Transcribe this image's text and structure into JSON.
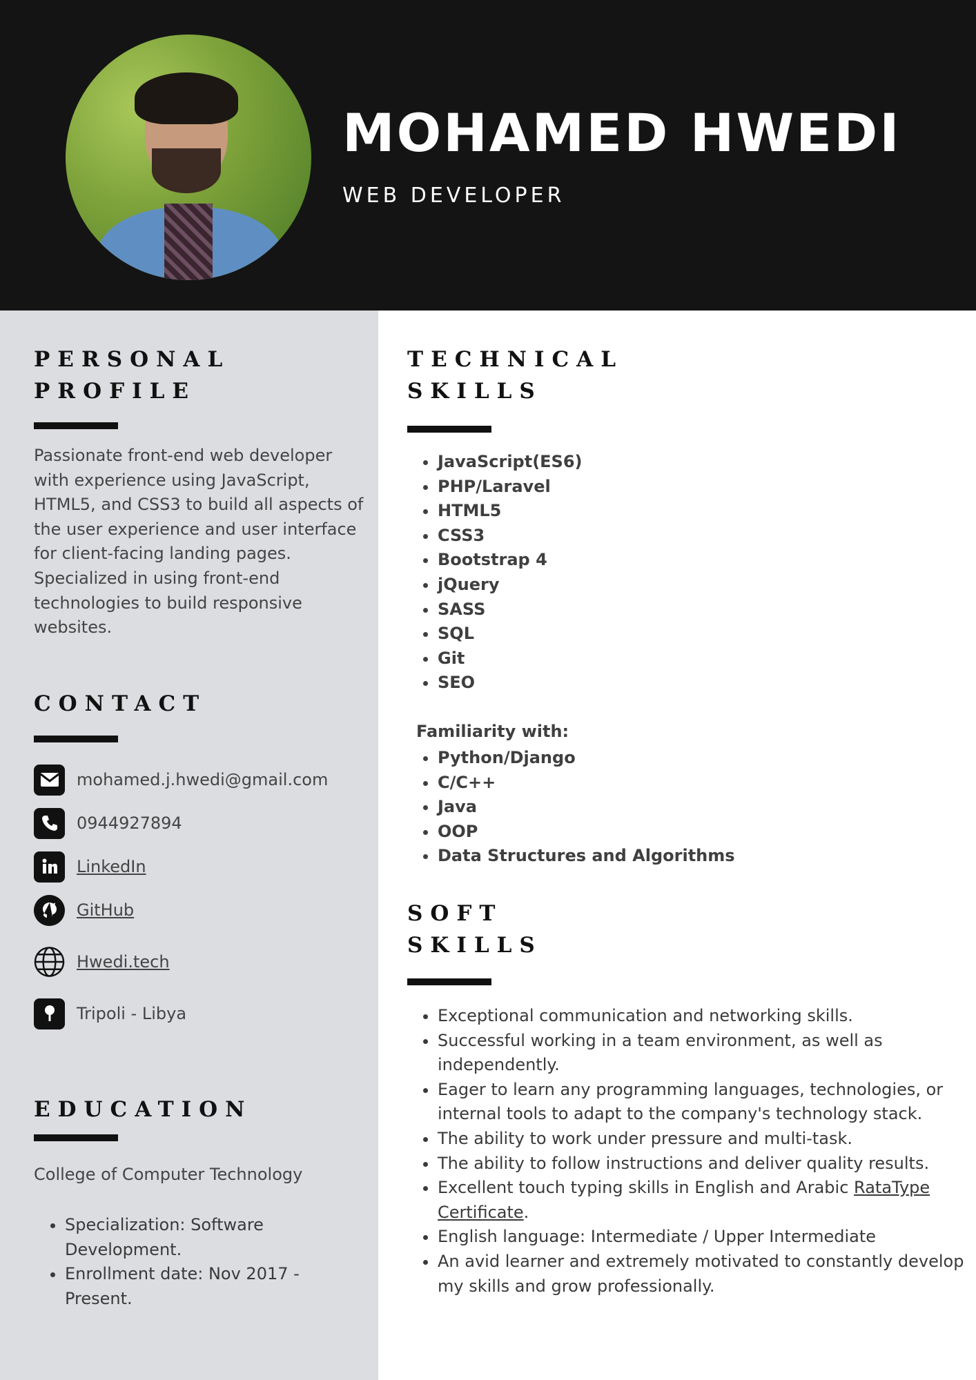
{
  "header": {
    "name": "MOHAMED HWEDI",
    "title": "WEB DEVELOPER",
    "photo_icon": "profile-photo"
  },
  "profile": {
    "heading": "PERSONAL\nPROFILE",
    "text": "Passionate front-end web developer with experience using JavaScript, HTML5, and CSS3 to build all aspects of the user experience and user interface for client-facing landing pages. Specialized in using front-end technologies to build responsive websites."
  },
  "contact": {
    "heading": "CONTACT",
    "items": [
      {
        "icon": "email-icon",
        "text": "mohamed.j.hwedi@gmail.com"
      },
      {
        "icon": "phone-icon",
        "text": "0944927894"
      },
      {
        "icon": "linkedin-icon",
        "text": "LinkedIn"
      },
      {
        "icon": "github-icon",
        "text": "GitHub"
      },
      {
        "icon": "globe-icon",
        "text": "Hwedi.tech"
      },
      {
        "icon": "location-pin-icon",
        "text": "Tripoli - Libya"
      }
    ]
  },
  "education": {
    "heading": "EDUCATION",
    "institution": "College of Computer Technology",
    "details": [
      "Specialization: Software Development.",
      "Enrollment date: Nov 2017 - Present."
    ]
  },
  "technical": {
    "heading": "TECHNICAL\nSKILLS",
    "skills": [
      "JavaScript(ES6)",
      "PHP/Laravel",
      "HTML5",
      "CSS3",
      "Bootstrap 4",
      "jQuery",
      "SASS",
      "SQL",
      "Git",
      "SEO"
    ],
    "familiarity_label": "Familiarity with:",
    "familiarity": [
      "Python/Django",
      "C/C++",
      "Java",
      "OOP",
      "Data Structures and Algorithms"
    ]
  },
  "soft": {
    "heading": "SOFT\nSKILLS",
    "skills": [
      "Exceptional communication and networking skills.",
      "Successful working in a team environment, as well as independently.",
      "Eager to learn any programming languages, technologies, or internal tools to adapt to the company's technology stack.",
      "The ability to work under pressure and multi-task.",
      "The ability to follow instructions and deliver quality results."
    ],
    "typing_text": "Excellent touch typing skills in English and Arabic",
    "typing_link": "RataType Certificate",
    "typing_period": ".",
    "skills_after": [
      "English language: Intermediate / Upper Intermediate",
      "An avid learner and extremely motivated to constantly develop my skills and grow professionally."
    ]
  }
}
